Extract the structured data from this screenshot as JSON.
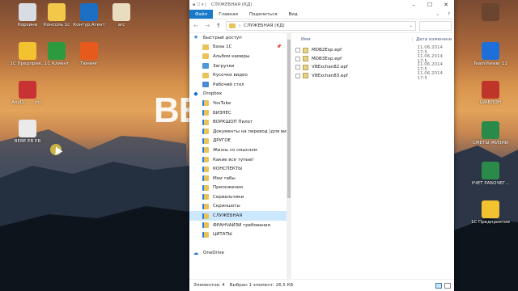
{
  "desktop": {
    "big_text": "BE",
    "icons": [
      {
        "label": "Корзина",
        "color": "#d8dde4"
      },
      {
        "label": "Консоль 1c",
        "color": "#f1c84a"
      },
      {
        "label": "Контур.Агент",
        "color": "#1c6fc5"
      },
      {
        "label": "arc",
        "color": "#e9ddc0"
      },
      {
        "label": "1С Предприя...",
        "color": "#f2c230"
      },
      {
        "label": "1С Клиент",
        "color": "#2e9a40"
      },
      {
        "label": "Тюнинг",
        "color": "#e85a1c"
      },
      {
        "label": "AnyD... ... nt...",
        "color": "#c83232"
      },
      {
        "label": "ВЕВЕ ЕВ ЕВ",
        "color": "#eaeaea"
      },
      {
        "label": "",
        "color": "#6c4530"
      },
      {
        "label": "TeamViewer 12",
        "color": "#1e6fd9"
      },
      {
        "label": "ШАБЛОН",
        "color": "#c0352a"
      },
      {
        "label": "СМЕТЫ ЖИЗНИ",
        "color": "#2a8a4a"
      },
      {
        "label": "УЧЕТ РАБОЧЕГ...",
        "color": "#2a8a4a"
      },
      {
        "label": "1С Предприятие",
        "color": "#f2c230"
      }
    ]
  },
  "explorer": {
    "title": "СЛУЖЕБНАЯ (КД)",
    "ribbon": {
      "file": "Файл",
      "tabs": [
        "Главная",
        "Поделиться",
        "Вид"
      ]
    },
    "address_path": "СЛУЖЕБНАЯ (КД)",
    "nav_items": [
      {
        "label": "Быстрый доступ",
        "icon": "star"
      },
      {
        "label": "Базы 1С",
        "icon": "folder",
        "pinned": true
      },
      {
        "label": "Альбом камеры",
        "icon": "folder"
      },
      {
        "label": "Загрузки",
        "icon": "blue"
      },
      {
        "label": "Кусочки видео",
        "icon": "folder"
      },
      {
        "label": "Рабочий стол",
        "icon": "desk"
      },
      {
        "label": "Dropbox",
        "icon": "drop"
      },
      {
        "label": "YouTube",
        "icon": "dfolder"
      },
      {
        "label": "БИЗНЕС",
        "icon": "dfolder"
      },
      {
        "label": "ВОРКШОП Пилот",
        "icon": "dfolder"
      },
      {
        "label": "Документы на перевод (для визы",
        "icon": "dfolder"
      },
      {
        "label": "ДРУГОЕ",
        "icon": "dfolder"
      },
      {
        "label": "Жизнь со смыслом",
        "icon": "dfolder"
      },
      {
        "label": "Какие все тупые!",
        "icon": "dfolder"
      },
      {
        "label": "КОНСПЕКТЫ",
        "icon": "dfolder"
      },
      {
        "label": "Мои табы",
        "icon": "dfolder"
      },
      {
        "label": "Приложения",
        "icon": "dfolder"
      },
      {
        "label": "Сериальчики",
        "icon": "dfolder"
      },
      {
        "label": "Скриншоты",
        "icon": "dfolder"
      },
      {
        "label": "СЛУЖЕБНАЯ",
        "icon": "dfolder"
      },
      {
        "label": "ФРАНЧАЙЗИ требования",
        "icon": "dfolder"
      },
      {
        "label": "ЦИТАТЫ",
        "icon": "dfolder"
      },
      {
        "label": "",
        "icon": "none"
      },
      {
        "label": "OneDrive",
        "icon": "cloud"
      }
    ],
    "columns": {
      "name": "Имя",
      "date": "Дата изменени"
    },
    "files": [
      {
        "name": "MDB2Exp.epf",
        "date": "11.06.2014 17:5"
      },
      {
        "name": "MDB3Exp.epf",
        "date": "11.06.2014 17:5"
      },
      {
        "name": "V8Exchan82.epf",
        "date": "11.06.2014 17:5"
      },
      {
        "name": "V8Exchan83.epf",
        "date": "11.06.2014 17:5"
      }
    ],
    "status": {
      "items": "Элементов: 4",
      "selected": "Выбран 1 элемент: 26,5 КБ"
    }
  }
}
